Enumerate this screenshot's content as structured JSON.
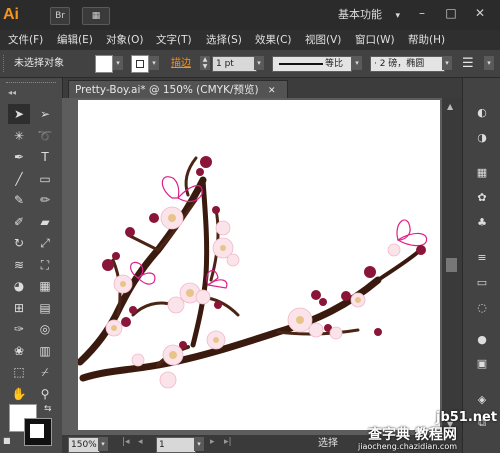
{
  "app": {
    "logo": "Ai",
    "bridge_button": "Br",
    "arrange_button": "▦",
    "workspace": "基本功能",
    "workspace_arrow": "▾",
    "minimize": "–",
    "maximize": "□",
    "close": "✕"
  },
  "menubar": {
    "items": [
      "文件(F)",
      "编辑(E)",
      "对象(O)",
      "文字(T)",
      "选择(S)",
      "效果(C)",
      "视图(V)",
      "窗口(W)",
      "帮助(H)"
    ]
  },
  "controlbar": {
    "selection_status": "未选择对象",
    "stroke_label": "描边",
    "stroke_weight": "1 pt",
    "stroke_profile": "等比",
    "brush": "· 2 磅，椭圆",
    "colors": {
      "fill": "#ffffff",
      "stroke_label": "#f7931e"
    }
  },
  "document": {
    "tab_title": "Pretty-Boy.ai* @ 150% (CMYK/预览)",
    "tab_close": "✕",
    "zoom": "150%",
    "page": "1",
    "status": "选择"
  },
  "tools": {
    "icons": [
      "selection-tool-icon",
      "direct-selection-tool-icon",
      "magic-wand-tool-icon",
      "lasso-tool-icon",
      "pen-tool-icon",
      "type-tool-icon",
      "line-tool-icon",
      "rectangle-tool-icon",
      "paintbrush-tool-icon",
      "pencil-tool-icon",
      "blob-brush-tool-icon",
      "eraser-tool-icon",
      "rotate-tool-icon",
      "scale-tool-icon",
      "width-tool-icon",
      "free-transform-tool-icon",
      "shape-builder-tool-icon",
      "perspective-grid-tool-icon",
      "mesh-tool-icon",
      "gradient-tool-icon",
      "eyedropper-tool-icon",
      "blend-tool-icon",
      "symbol-sprayer-tool-icon",
      "column-graph-tool-icon",
      "artboard-tool-icon",
      "slice-tool-icon",
      "hand-tool-icon",
      "zoom-tool-icon"
    ]
  },
  "watermark": {
    "line1": "jb51.net",
    "line2": "查字典 教程网",
    "line3": "jiaocheng.chazidian.com"
  }
}
